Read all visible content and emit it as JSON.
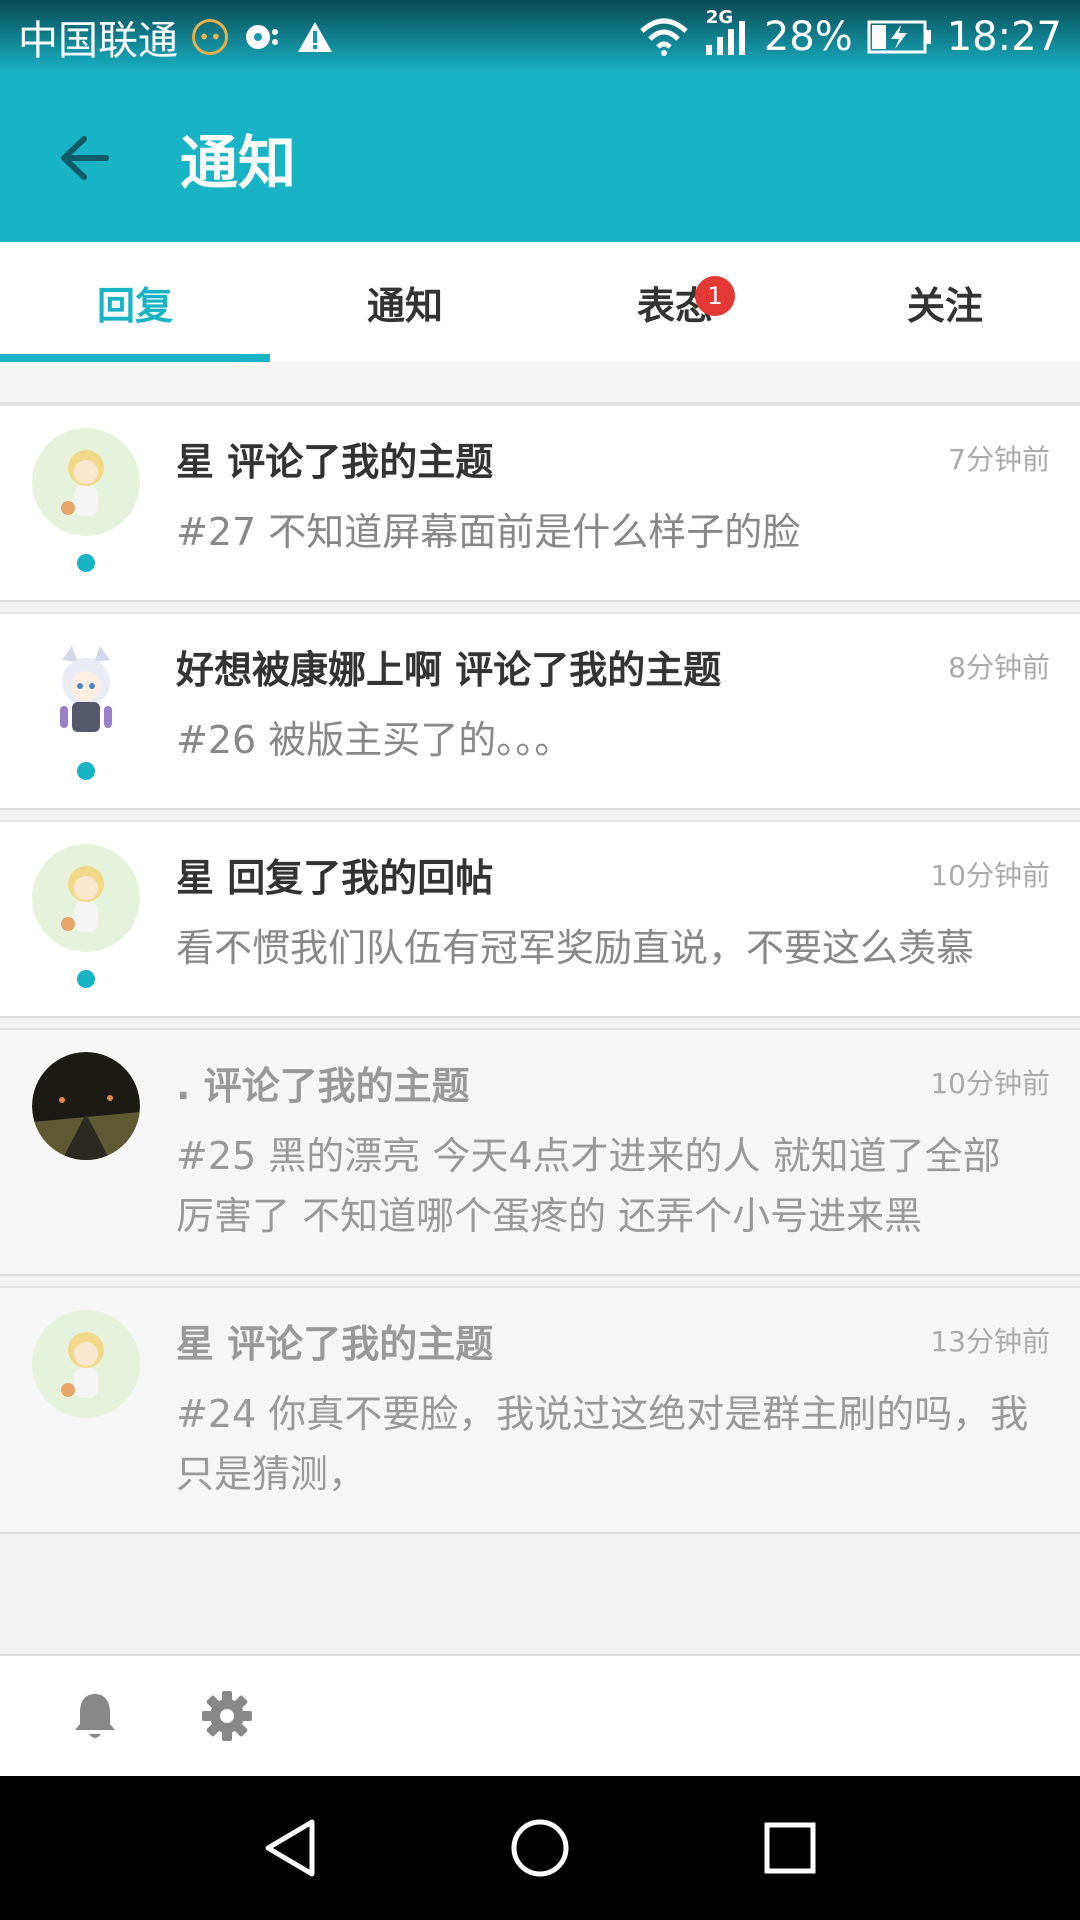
{
  "status_bar": {
    "carrier": "中国联通",
    "network": "2G",
    "battery": "28%",
    "time": "18:27"
  },
  "app_bar": {
    "title": "通知"
  },
  "tabs": [
    {
      "label": "回复",
      "active": true
    },
    {
      "label": "通知",
      "active": false
    },
    {
      "label": "表态",
      "active": false,
      "badge": "1"
    },
    {
      "label": "关注",
      "active": false
    }
  ],
  "items": [
    {
      "title": "星 评论了我的主题",
      "time": "7分钟前",
      "body": "#27 不知道屏幕面前是什么样子的脸",
      "unread": true
    },
    {
      "title": "好想被康娜上啊 评论了我的主题",
      "time": "8分钟前",
      "body": "#26 被版主买了的。。。",
      "unread": true
    },
    {
      "title": "星 回复了我的回帖",
      "time": "10分钟前",
      "body": "看不惯我们队伍有冠军奖励直说，不要这么羡慕",
      "unread": true
    },
    {
      "title": ". 评论了我的主题",
      "time": "10分钟前",
      "body": "#25 黑的漂亮 今天4点才进来的人 就知道了全部 厉害了 不知道哪个蛋疼的 还弄个小号进来黑",
      "unread": false
    },
    {
      "title": "星 评论了我的主题",
      "time": "13分钟前",
      "body": "#24 你真不要脸，我说过这绝对是群主刷的吗，我只是猜测，",
      "unread": false
    }
  ],
  "icons": {
    "back": "arrow-left-icon",
    "bell": "bell-icon",
    "settings": "gear-icon"
  },
  "colors": {
    "accent": "#18b4c6",
    "badge": "#e53935"
  }
}
